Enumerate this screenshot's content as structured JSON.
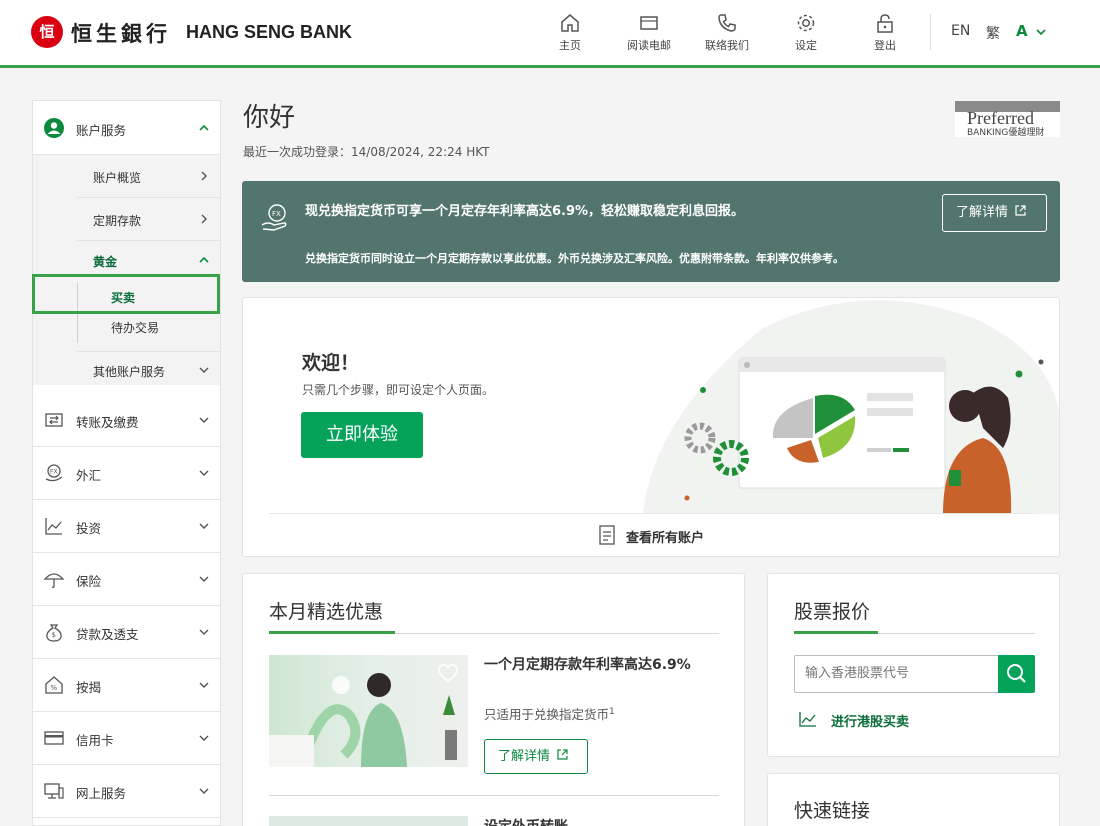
{
  "header": {
    "logo_mark": "恒",
    "logo_cn": "恒生銀行",
    "logo_en": "HANG SENG BANK",
    "nav": [
      {
        "label": "主页",
        "icon": "home-icon"
      },
      {
        "label": "阅读电邮",
        "icon": "mail-icon"
      },
      {
        "label": "联络我们",
        "icon": "phone-icon"
      },
      {
        "label": "设定",
        "icon": "gear-icon"
      },
      {
        "label": "登出",
        "icon": "lock-icon"
      }
    ],
    "lang_en": "EN",
    "lang_tc": "繁",
    "font_size": "A"
  },
  "sidebar": {
    "account_services": "账户服务",
    "sub_items": [
      "账户概览",
      "定期存款",
      "黄金"
    ],
    "gold_sub": [
      "买卖",
      "待办交易"
    ],
    "other_services": "其他账户服务",
    "items": [
      {
        "label": "转账及缴费",
        "icon": "transfer-icon"
      },
      {
        "label": "外汇",
        "icon": "fx-icon"
      },
      {
        "label": "投资",
        "icon": "chart-line-icon"
      },
      {
        "label": "保险",
        "icon": "umbrella-icon"
      },
      {
        "label": "贷款及透支",
        "icon": "money-bag-icon"
      },
      {
        "label": "按揭",
        "icon": "house-icon"
      },
      {
        "label": "信用卡",
        "icon": "credit-card-icon"
      },
      {
        "label": "网上服务",
        "icon": "computer-icon"
      }
    ]
  },
  "main": {
    "greeting": "你好",
    "last_login": "最近一次成功登录：14/08/2024, 22:24 HKT",
    "preferred_line1": "Preferred",
    "preferred_line2": "BANKING優越理財",
    "banner": {
      "title": "现兑换指定货币可享一个月定存年利率高达6.9%，轻松赚取稳定利息回报。",
      "note": "兑换指定货币同时设立一个月定期存款以享此优惠。外币兑换涉及汇率风险。优惠附带条款。年利率仅供参考。",
      "button": "了解详情"
    },
    "welcome": {
      "title": "欢迎！",
      "subtitle": "只需几个步骤，即可设定个人页面。",
      "button": "立即体验",
      "view_all": "查看所有账户"
    },
    "offers": {
      "title": "本月精选优惠",
      "headline": "一个月定期存款年利率高达6.9%",
      "sub": "只适用于兑换指定货币",
      "sub_sup": "1",
      "button": "了解详情",
      "next_headline": "设定外币转账..."
    },
    "stocks": {
      "title": "股票报价",
      "placeholder": "输入香港股票代号",
      "link": "进行港股买卖"
    },
    "quick_links": {
      "title": "快速链接"
    }
  },
  "colors": {
    "brand_green": "#3aa04a",
    "button_green": "#05a35a",
    "banner_bg": "#52756f",
    "logo_red": "#db0011"
  }
}
